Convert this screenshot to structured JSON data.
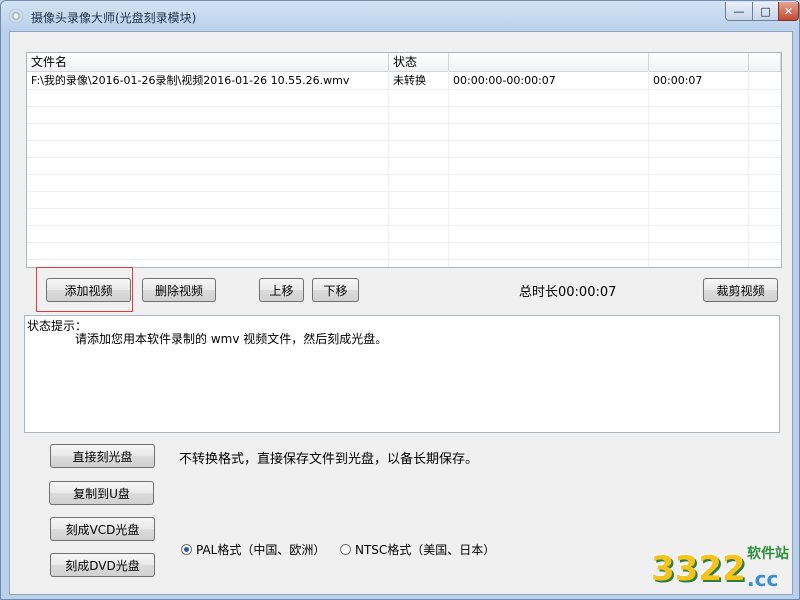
{
  "window": {
    "title": "摄像头录像大师(光盘刻录模块)",
    "minimize_glyph": "—",
    "maximize_glyph": "□",
    "close_glyph": "✕"
  },
  "file_list": {
    "columns": [
      "文件名",
      "状态",
      "",
      "",
      ""
    ],
    "rows": [
      {
        "name": "F:\\我的录像\\2016-01-26录制\\视频2016-01-26 10.55.26.wmv",
        "status": "未转换",
        "range": "00:00:00-00:00:07",
        "duration": "00:00:07"
      }
    ]
  },
  "buttons": {
    "add_video": "添加视频",
    "delete_video": "删除视频",
    "move_up": "上移",
    "move_down": "下移",
    "trim_video": "裁剪视频",
    "burn_direct": "直接刻光盘",
    "copy_to_u": "复制到U盘",
    "burn_vcd": "刻成VCD光盘",
    "burn_dvd": "刻成DVD光盘"
  },
  "total_duration": "总时长00:00:07",
  "status": {
    "title": "状态提示：",
    "message": "请添加您用本软件录制的 wmv 视频文件，然后刻成光盘。"
  },
  "burn_description": "不转换格式，直接保存文件到光盘，以备长期保存。",
  "format": {
    "pal_label": "PAL格式（中国、欧洲）",
    "ntsc_label": "NTSC格式（美国、日本）",
    "selected": "PAL"
  },
  "watermark": {
    "number": "3322",
    "suffix": ".cc",
    "site": "软件站"
  },
  "colors": {
    "highlight_border": "#e23b3b",
    "title_bar": "#b9d1eb"
  }
}
